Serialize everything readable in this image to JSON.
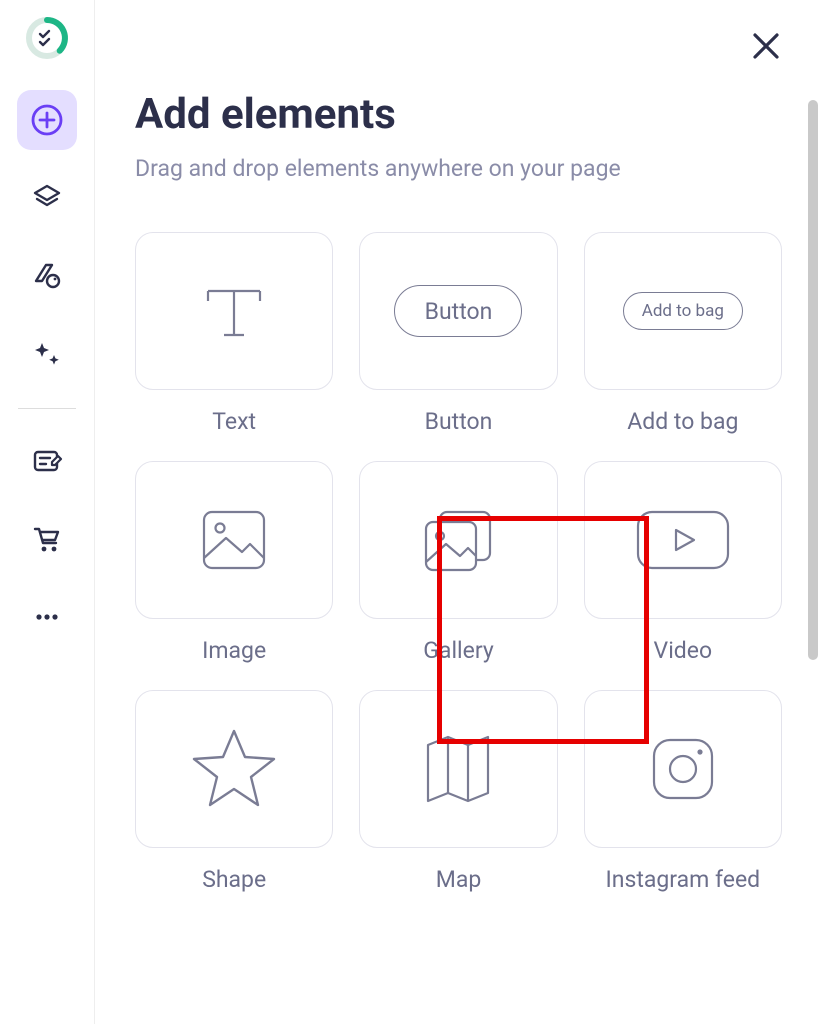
{
  "header": {
    "title": "Add elements",
    "subtitle": "Drag and drop elements anywhere on your page"
  },
  "sidebar": {
    "items": [
      {
        "name": "add",
        "icon": "plus-circle-icon",
        "active": true
      },
      {
        "name": "layers",
        "icon": "layers-icon",
        "active": false
      },
      {
        "name": "theme",
        "icon": "palette-icon",
        "active": false
      },
      {
        "name": "effects",
        "icon": "sparkle-icon",
        "active": false
      },
      {
        "name": "edit",
        "icon": "form-edit-icon",
        "active": false
      },
      {
        "name": "cart",
        "icon": "cart-icon",
        "active": false
      },
      {
        "name": "more",
        "icon": "more-icon",
        "active": false
      }
    ]
  },
  "elements": [
    {
      "id": "text",
      "label": "Text",
      "icon": "text-icon"
    },
    {
      "id": "button",
      "label": "Button",
      "icon": "button-pill",
      "pill_text": "Button"
    },
    {
      "id": "add-to-bag",
      "label": "Add to bag",
      "icon": "add-to-bag-pill",
      "pill_text": "Add to bag"
    },
    {
      "id": "image",
      "label": "Image",
      "icon": "image-icon"
    },
    {
      "id": "gallery",
      "label": "Gallery",
      "icon": "gallery-icon",
      "highlighted": true
    },
    {
      "id": "video",
      "label": "Video",
      "icon": "video-icon"
    },
    {
      "id": "shape",
      "label": "Shape",
      "icon": "star-icon"
    },
    {
      "id": "map",
      "label": "Map",
      "icon": "map-fold-icon"
    },
    {
      "id": "instagram",
      "label": "Instagram feed",
      "icon": "instagram-icon"
    }
  ],
  "highlight": {
    "target_element": "gallery"
  },
  "colors": {
    "text_primary": "#2c2f4a",
    "text_muted": "#8a8ca8",
    "accent_bg": "#e4deff",
    "accent": "#6a3ef5",
    "border": "#e3e3ec",
    "highlight": "#e60000",
    "brand_green": "#1db686"
  }
}
